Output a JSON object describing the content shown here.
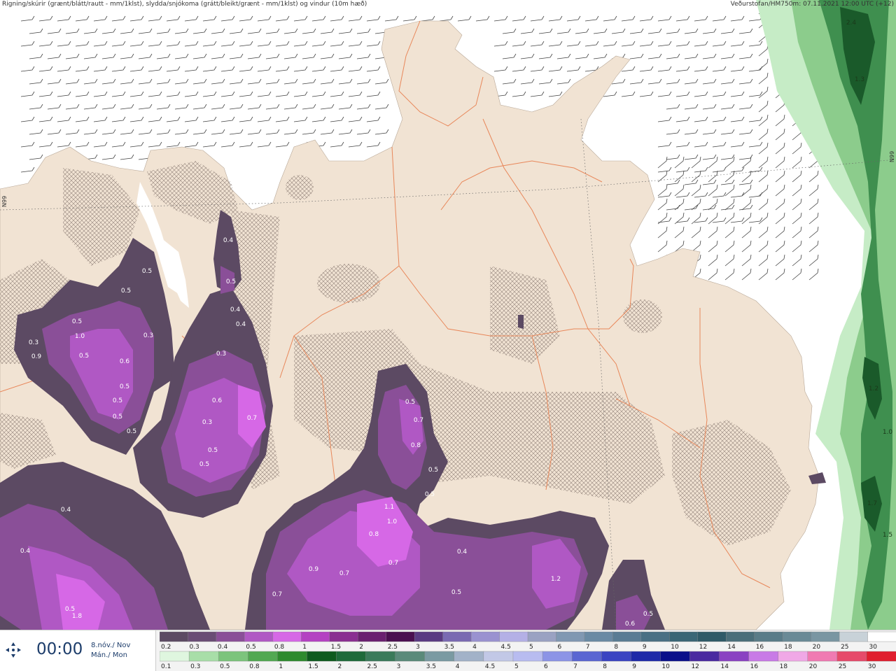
{
  "header": {
    "left": "Rigning/skúrir (grænt/blátt/rautt - mm/1klst), slydda/snjókoma (grátt/bleikt/grænt - mm/1klst) og vindur (10m hæð)",
    "right": "Veðurstofan/HM750m: 07.11.2021 12:00 UTC (+12)"
  },
  "lat_labels": {
    "left": "N99",
    "right": "N99"
  },
  "time_panel": {
    "time": "00:00",
    "date_line1": "8.nóv./ Nov",
    "date_line2": "Mán./ Mon"
  },
  "snow_legend": {
    "labels": [
      "0.2",
      "0.3",
      "0.4",
      "0.5",
      "0.8",
      "1",
      "1.5",
      "2",
      "2.5",
      "3",
      "3.5",
      "4",
      "4.5",
      "5",
      "6",
      "7",
      "8",
      "9",
      "10",
      "12",
      "14",
      "16",
      "18",
      "20",
      "25",
      "30"
    ],
    "colors": [
      "#5c4a63",
      "#6a4d75",
      "#8a4f98",
      "#b058c4",
      "#d668e6",
      "#b442c2",
      "#8a2f91",
      "#6a2070",
      "#4a0f50",
      "#5a3a82",
      "#7a6ab2",
      "#9a92d0",
      "#b4b0e6",
      "#9aa2c2",
      "#8098b2",
      "#6a8aa4",
      "#5a7c94",
      "#4a7084",
      "#3a6676",
      "#2f5a68",
      "#4a6e7a",
      "#5a7c88",
      "#6a8a96",
      "#7a96a2",
      "#c8d2d8",
      "#ffffff"
    ]
  },
  "rain_legend": {
    "labels": [
      "0.1",
      "0.3",
      "0.5",
      "0.8",
      "1",
      "1.5",
      "2",
      "2.5",
      "3",
      "3.5",
      "4",
      "4.5",
      "5",
      "6",
      "7",
      "8",
      "9",
      "10",
      "12",
      "14",
      "16",
      "18",
      "20",
      "25",
      "30"
    ],
    "colors": [
      "#dff6df",
      "#a8dea8",
      "#7cc47c",
      "#52a852",
      "#2e8a2e",
      "#0e5a1e",
      "#1e6a3a",
      "#3a7a5a",
      "#5a8a7a",
      "#7a9aa2",
      "#a2b2c8",
      "#c2c8e6",
      "#b8bcf0",
      "#8c94e6",
      "#5a66d2",
      "#3a44c2",
      "#1e2aa8",
      "#0a108a",
      "#4a2aa0",
      "#8a42c2",
      "#c87ae6",
      "#f0a8e6",
      "#f07ab2",
      "#e64a6a",
      "#e01e2e"
    ]
  },
  "precip_labels": [
    {
      "text": "0.4"
    },
    {
      "text": "0.5"
    },
    {
      "text": "0.4"
    },
    {
      "text": "0.4"
    },
    {
      "text": "0.3"
    },
    {
      "text": "0.6"
    },
    {
      "text": "0.3"
    },
    {
      "text": "0.5"
    },
    {
      "text": "0.5"
    },
    {
      "text": "0.7"
    },
    {
      "text": "0.5"
    },
    {
      "text": "0.5"
    },
    {
      "text": "0.5"
    },
    {
      "text": "1.0"
    },
    {
      "text": "0.3"
    },
    {
      "text": "0.9"
    },
    {
      "text": "0.3"
    },
    {
      "text": "0.5"
    },
    {
      "text": "0.6"
    },
    {
      "text": "0.5"
    },
    {
      "text": "0.5"
    },
    {
      "text": "0.5"
    },
    {
      "text": "0.5"
    },
    {
      "text": "0.4"
    },
    {
      "text": "0.4"
    },
    {
      "text": "0.5"
    },
    {
      "text": "1.8"
    },
    {
      "text": "0.5"
    },
    {
      "text": "0.7"
    },
    {
      "text": "0.8"
    },
    {
      "text": "0.5"
    },
    {
      "text": "0.5"
    },
    {
      "text": "1.1"
    },
    {
      "text": "1.0"
    },
    {
      "text": "0.8"
    },
    {
      "text": "0.7"
    },
    {
      "text": "0.9"
    },
    {
      "text": "0.7"
    },
    {
      "text": "0.7"
    },
    {
      "text": "0.4"
    },
    {
      "text": "0.5"
    },
    {
      "text": "1.2"
    },
    {
      "text": "0.6"
    },
    {
      "text": "0.5"
    },
    {
      "text": "2.4"
    },
    {
      "text": "1.3"
    },
    {
      "text": "1.2"
    },
    {
      "text": "1.0"
    },
    {
      "text": "1.7"
    },
    {
      "text": "1.5"
    }
  ],
  "colors": {
    "land": "#f1e3d3",
    "sea": "#ffffff",
    "roads": "#e8875a",
    "snow_dark": "#5c4a63",
    "snow_mid": "#8a4f98",
    "snow_light": "#b058c4",
    "snow_bright": "#d668e6",
    "rain_light": "#c6ecc6",
    "rain_mid": "#8ccc8c",
    "rain_dark": "#3f8f4f",
    "rain_darkest": "#1a5a2a"
  }
}
